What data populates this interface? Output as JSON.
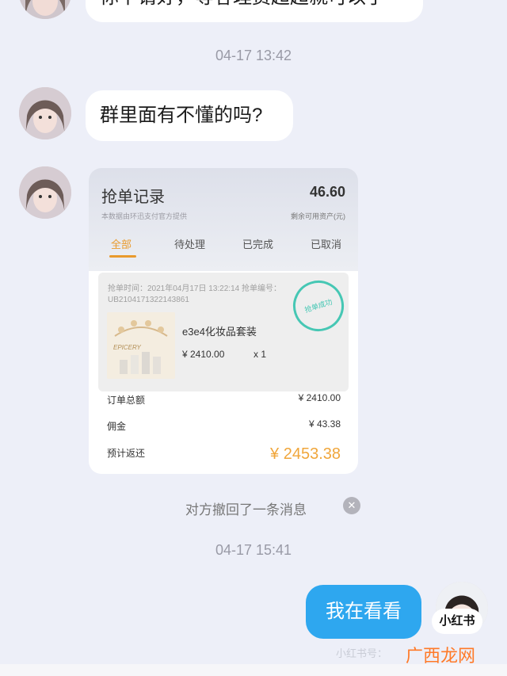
{
  "messages": {
    "partial_text": "你下请好，等客理费超超就可以了",
    "time1": "04-17 13:42",
    "question": "群里面有不懂的吗?",
    "time2": "04-17 15:41",
    "recalled": "对方撤回了一条消息",
    "my_reply": "我在看看"
  },
  "card": {
    "title": "抢单记录",
    "subtitle": "本数据由环迅支付官方提供",
    "amount": "46.60",
    "amount_label": "剩余可用资产(元)",
    "tabs": [
      "全部",
      "待处理",
      "已完成",
      "已取消"
    ],
    "order": {
      "time_label": "抢单时间：2021年04月17日 13:22:14 抢单编号：",
      "order_no": "UB2104171322143861",
      "stamp": "抢单成功",
      "product_name": "e3e4化妆品套装",
      "price": "¥ 2410.00",
      "qty": "x 1",
      "img_text": "EPICERY"
    },
    "rows": {
      "total_label": "订单总额",
      "total_value": "¥ 2410.00",
      "commission_label": "佣金",
      "commission_value": "¥ 43.38",
      "return_label": "预计返还",
      "return_value": "¥ 2453.38"
    }
  },
  "watermarks": {
    "badge": "小红书",
    "account": "小红书号：",
    "site": "广西龙网"
  },
  "colors": {
    "accent_orange": "#f0a63b",
    "my_bubble": "#2ea7ef",
    "stamp": "#46c7b4"
  }
}
